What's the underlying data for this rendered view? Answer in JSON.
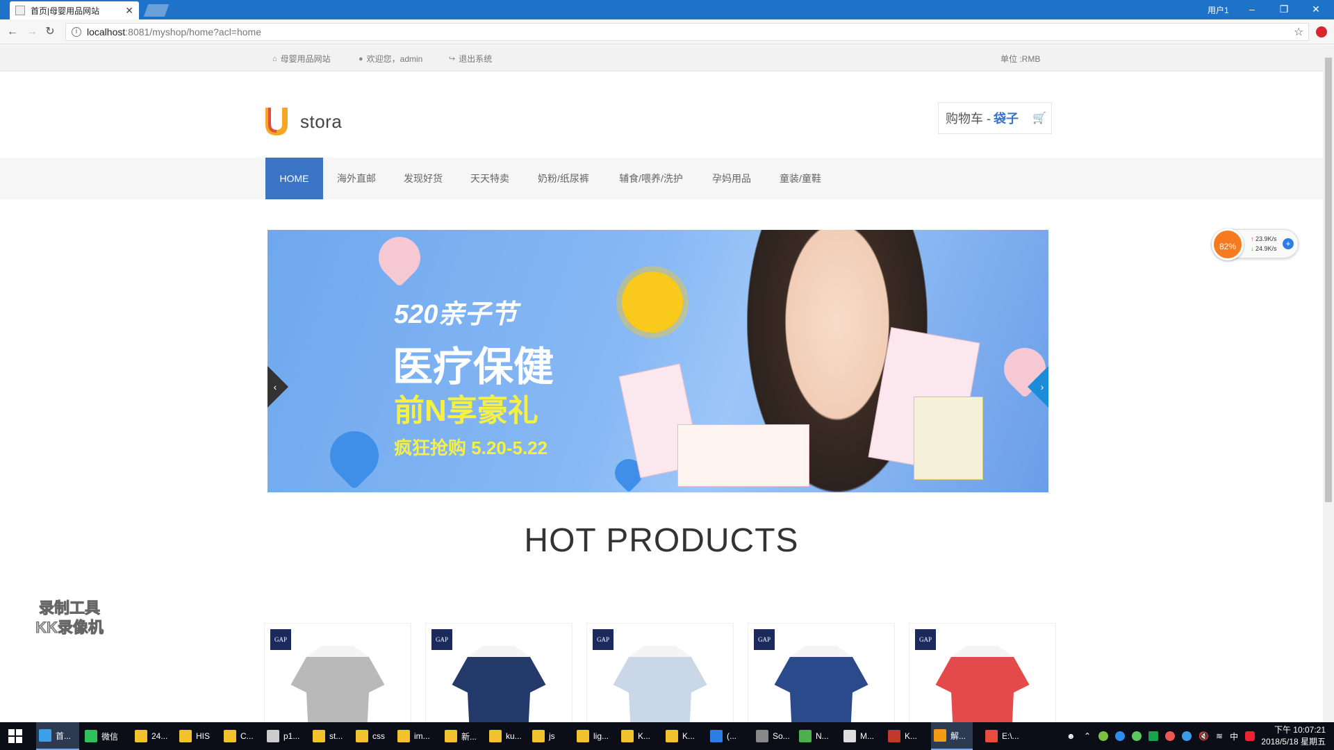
{
  "browser": {
    "tab_title": "首页|母婴用品网站",
    "tab_close": "✕",
    "user_label": "用户1",
    "url_host": "localhost",
    "url_rest": ":8081/myshop/home?acl=home"
  },
  "topbar": {
    "site_link": "母婴用品网站",
    "welcome": "欢迎您，admin",
    "logout": "退出系统",
    "currency": "单位 :RMB"
  },
  "header": {
    "logo_text": "stora",
    "cart_label": "购物车 -",
    "cart_value": "袋子"
  },
  "nav": {
    "items": [
      {
        "label": "HOME"
      },
      {
        "label": "海外直邮"
      },
      {
        "label": "发现好货"
      },
      {
        "label": "天天特卖"
      },
      {
        "label": "奶粉/纸尿裤"
      },
      {
        "label": "辅食/喂养/洗护"
      },
      {
        "label": "孕妈用品"
      },
      {
        "label": "童装/童鞋"
      }
    ]
  },
  "banner": {
    "line1": "520亲子节",
    "line2": "医疗保健",
    "line3": "前N享豪礼",
    "line4": "疯狂抢购 5.20-5.22",
    "prev_glyph": "‹",
    "next_glyph": "›"
  },
  "section": {
    "hot_title": "HOT PRODUCTS"
  },
  "products": [
    {
      "badge": "GAP",
      "color": "#b9b9b9"
    },
    {
      "badge": "GAP",
      "color": "#243a6b"
    },
    {
      "badge": "GAP",
      "color": "#c9d7e6"
    },
    {
      "badge": "GAP",
      "color": "#2a4a8c"
    },
    {
      "badge": "GAP",
      "color": "#e44a4a"
    }
  ],
  "net_widget": {
    "percent": "82%",
    "up": "23.9K/s",
    "down": "24.9K/s",
    "plus": "+"
  },
  "watermark": {
    "line1": "录制工具",
    "line2": "KK录像机"
  },
  "taskbar": {
    "items": [
      {
        "label": "首..."
      },
      {
        "label": "微信"
      },
      {
        "label": "24..."
      },
      {
        "label": "HIS"
      },
      {
        "label": "C..."
      },
      {
        "label": "p1..."
      },
      {
        "label": "st..."
      },
      {
        "label": "css"
      },
      {
        "label": "im..."
      },
      {
        "label": "新..."
      },
      {
        "label": "ku..."
      },
      {
        "label": "js"
      },
      {
        "label": "lig..."
      },
      {
        "label": "K..."
      },
      {
        "label": "K..."
      },
      {
        "label": "(..."
      },
      {
        "label": "So..."
      },
      {
        "label": "N..."
      },
      {
        "label": "M..."
      },
      {
        "label": "K..."
      },
      {
        "label": "解..."
      },
      {
        "label": "E:\\..."
      }
    ],
    "ime": "中",
    "time": "下午 10:07:21",
    "date": "2018/5/18 星期五"
  }
}
